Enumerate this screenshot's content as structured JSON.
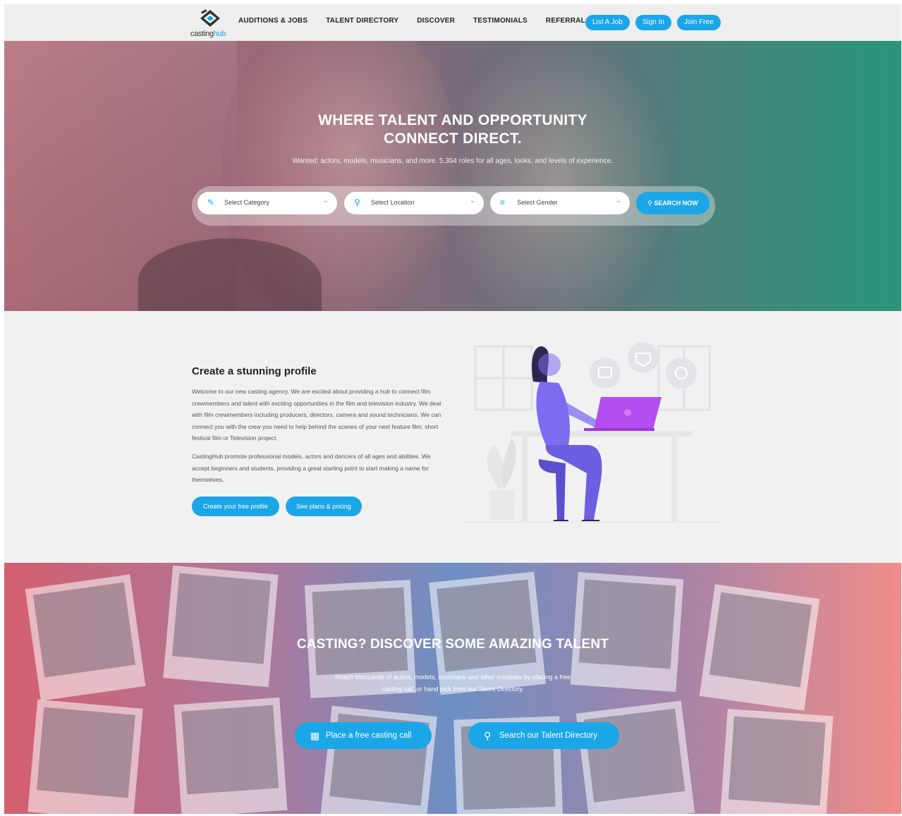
{
  "header": {
    "logo": {
      "text_main": "casting",
      "text_accent": "hub"
    },
    "nav": [
      "AUDITIONS & JOBS",
      "TALENT DIRECTORY",
      "DISCOVER",
      "TESTIMONIALS",
      "REFERRAL"
    ],
    "buttons": {
      "list_job": "List A Job",
      "sign_in": "Sign In",
      "join_free": "Join Free"
    }
  },
  "hero": {
    "title_line1": "WHERE TALENT AND OPPORTUNITY",
    "title_line2": "CONNECT DIRECT.",
    "subtitle": "Wanted: actors, models, musicians, and more. 5,354 roles for all ages, looks, and levels of experience.",
    "search": {
      "category_placeholder": "Select Category",
      "location_placeholder": "Select Location",
      "gender_placeholder": "Select Gender",
      "button": "SEARCH NOW"
    }
  },
  "profile": {
    "title": "Create a stunning profile",
    "para1": "Welcome to our new casting agency. We are excited about providing a hub to connect film crewmembers and talent with exciting opportunities in the film and television industry. We deal with film crewmembers including producers, directors, camera and sound technicians. We can connect you with the crew you need to help behind the scenes of your next feature film, short festival film or Television project.",
    "para2": "CastingHub promote professional models, actors and dancers of all ages and abilities. We accept beginners and students, providing a great starting point to start making a name for themselves.",
    "btn_create": "Create your free profile",
    "btn_plans": "See plans & pricing"
  },
  "casting": {
    "title": "CASTING? DISCOVER SOME AMAZING TALENT",
    "subtitle": "Reach thousands of actors, models, musicians and other creatives by placing a free casting call, or hand pick from our Talent Directory.",
    "btn_place": "Place a free casting call",
    "btn_search": "Search our Talent Directory"
  },
  "colors": {
    "accent": "#1ba6e8",
    "section_bg": "#f1f1f1",
    "illustration_purple": "#7b6cf0"
  }
}
